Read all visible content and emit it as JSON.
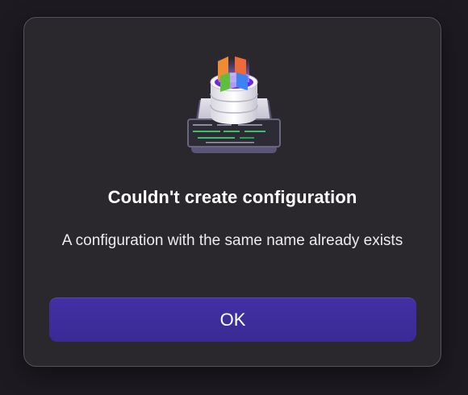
{
  "alert": {
    "title": "Couldn't create configuration",
    "message": "A configuration with the same name already exists",
    "ok_label": "OK"
  },
  "icons": {
    "app": "database-configuration-app-icon"
  },
  "colors": {
    "window_background": "#1d1b21",
    "dialog_background": "#2a272d",
    "dialog_border": "#56535a",
    "button_background": "#3d2e9c",
    "text": "#ffffff"
  }
}
